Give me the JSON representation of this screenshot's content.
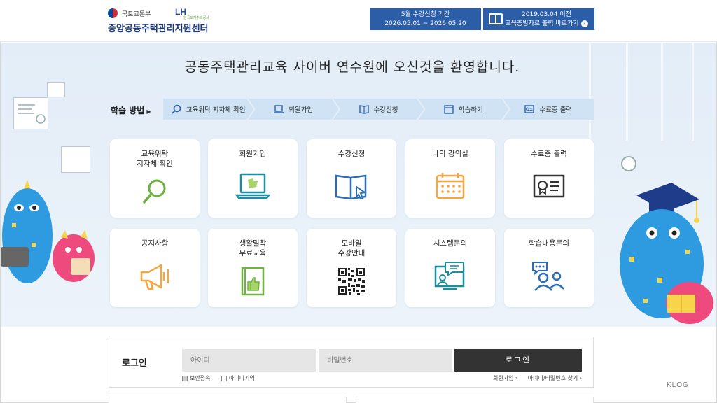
{
  "header": {
    "ministry": "국토교통부",
    "lh": "LH",
    "lh_sub": "한국토지주택공사",
    "site_name": "중앙공동주택관리지원센터",
    "notice1_line1": "5월 수강신청 기간",
    "notice1_line2": "2026.05.01 ~ 2026.05.20",
    "notice2_line1": "2019.03.04 이전",
    "notice2_line2": "교육증빙자료 출력 바로가기"
  },
  "welcome": "공동주택관리교육 사이버 연수원에 오신것을 환영합니다.",
  "study": {
    "label": "학습 방법",
    "steps": [
      "교육위탁 지자체 확인",
      "회원가입",
      "수강신청",
      "학습하기",
      "수료증 출력"
    ]
  },
  "cards": [
    {
      "title": "교육위탁\n지자체 확인",
      "icon": "magnifier-icon"
    },
    {
      "title": "회원가입",
      "icon": "laptop-puzzle-icon"
    },
    {
      "title": "수강신청",
      "icon": "book-cursor-icon"
    },
    {
      "title": "나의 강의실",
      "icon": "calendar-icon"
    },
    {
      "title": "수료증 출력",
      "icon": "certificate-icon"
    },
    {
      "title": "공지사항",
      "icon": "megaphone-icon"
    },
    {
      "title": "생활밀착\n무료교육",
      "icon": "thumbs-up-book-icon"
    },
    {
      "title": "모바일\n수강안내",
      "icon": "qr-code-icon"
    },
    {
      "title": "시스템문의",
      "icon": "monitor-chat-icon"
    },
    {
      "title": "학습내용문의",
      "icon": "people-chat-icon"
    }
  ],
  "login": {
    "title": "로그인",
    "id_placeholder": "아이디",
    "pw_placeholder": "비밀번호",
    "button": "로그인",
    "secure": "보안접속",
    "remember": "아이디기억",
    "join": "회원가입 ›",
    "find": "아이디/비밀번호 찾기 ›"
  },
  "watermark": "KLOG",
  "colors": {
    "header_box": "#2c5ea8",
    "bg": "#e3edf7",
    "step": "#cfe3f5",
    "green": "#6cb33f",
    "orange": "#f5a640",
    "blue": "#2c6db3"
  }
}
